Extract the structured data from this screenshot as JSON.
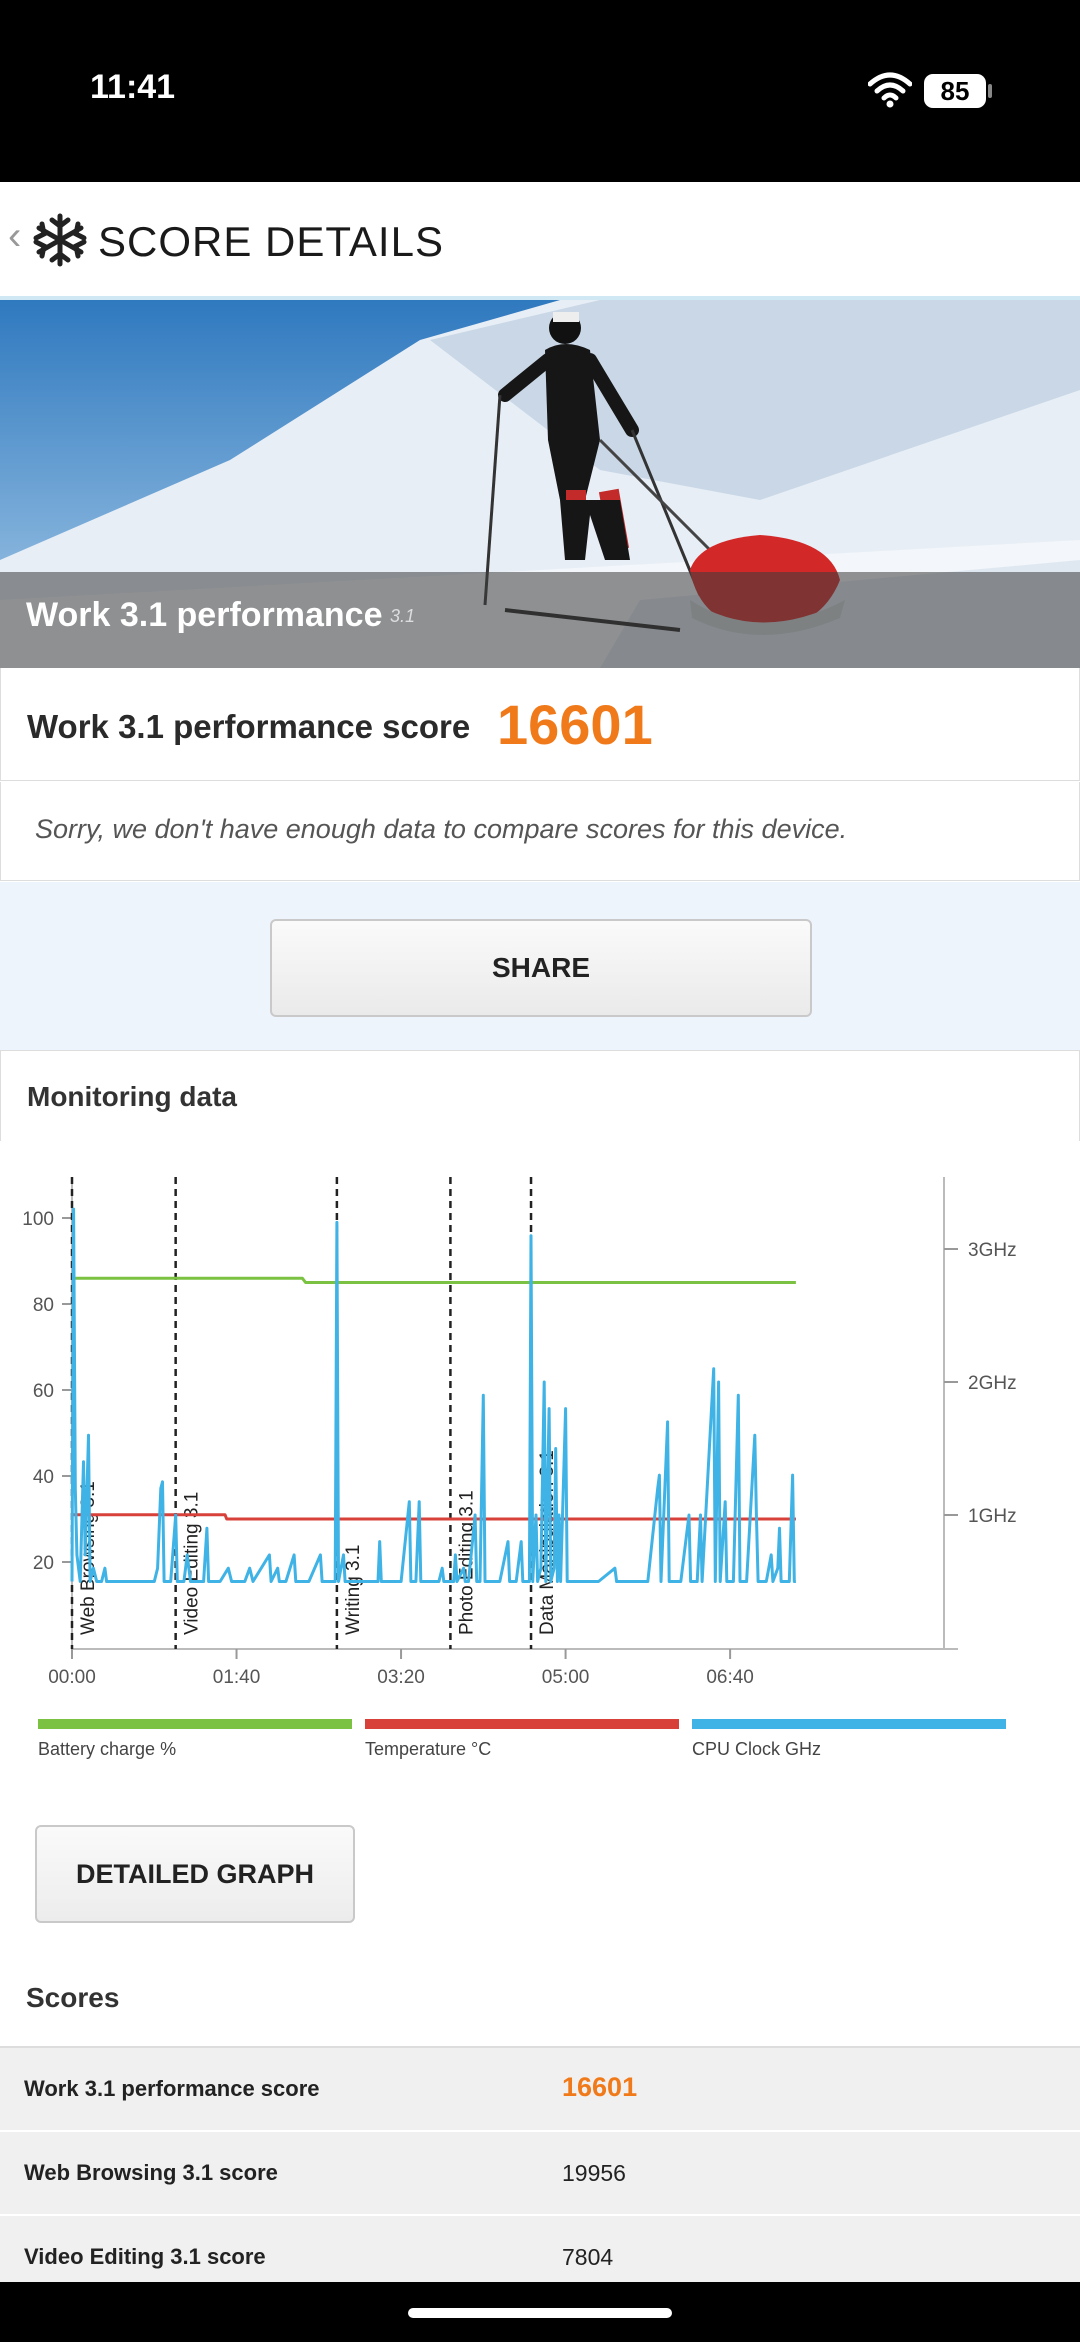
{
  "status_bar": {
    "time": "11:41",
    "battery": "85"
  },
  "header": {
    "title": "SCORE DETAILS",
    "back_glyph": "‹"
  },
  "hero": {
    "title": "Work 3.1 performance",
    "version": "3.1"
  },
  "score": {
    "label": "Work 3.1 performance score",
    "value": "16601"
  },
  "notice": "Sorry, we don't have enough data to compare scores for this device.",
  "share_label": "SHARE",
  "monitoring": {
    "title": "Monitoring data"
  },
  "colors": {
    "battery": "#7cc242",
    "temperature": "#d8403a",
    "cpu": "#3fb3e5",
    "accent": "#f07a1a"
  },
  "chart_data": {
    "type": "line",
    "x_ticks": [
      "00:00",
      "01:40",
      "03:20",
      "05:00",
      "06:40"
    ],
    "x_range_seconds": [
      0,
      530
    ],
    "y_left_ticks": [
      "100",
      "80",
      "60",
      "40",
      "20"
    ],
    "y_left_range": [
      0,
      100
    ],
    "y_right_ticks": [
      "3GHz",
      "2GHz",
      "1GHz"
    ],
    "y_right_range_ghz": [
      0,
      3.5
    ],
    "markers": [
      {
        "label": "Web Browsing 3.1",
        "t": 0
      },
      {
        "label": "Video Editing 3.1",
        "t": 63
      },
      {
        "label": "Writing 3.1",
        "t": 161
      },
      {
        "label": "Photo Editing 3.1",
        "t": 230
      },
      {
        "label": "Data Manipulation 3.1",
        "t": 279
      }
    ],
    "series": [
      {
        "name": "Battery charge %",
        "axis": "left",
        "points": [
          [
            0,
            86
          ],
          [
            140,
            86
          ],
          [
            142,
            85
          ],
          [
            440,
            85
          ]
        ]
      },
      {
        "name": "Temperature °C",
        "axis": "left",
        "points": [
          [
            0,
            31
          ],
          [
            93,
            31
          ],
          [
            94,
            30
          ],
          [
            440,
            30
          ]
        ]
      },
      {
        "name": "CPU Clock GHz",
        "axis": "right",
        "points": [
          [
            0,
            0.5
          ],
          [
            1,
            3.3
          ],
          [
            2,
            1.2
          ],
          [
            3,
            0.7
          ],
          [
            5,
            0.5
          ],
          [
            7,
            1.4
          ],
          [
            8,
            0.7
          ],
          [
            10,
            1.6
          ],
          [
            11,
            0.5
          ],
          [
            13,
            0.6
          ],
          [
            15,
            0.5
          ],
          [
            18,
            0.5
          ],
          [
            20,
            0.6
          ],
          [
            21,
            0.5
          ],
          [
            30,
            0.5
          ],
          [
            40,
            0.5
          ],
          [
            50,
            0.5
          ],
          [
            52,
            0.6
          ],
          [
            54,
            1.2
          ],
          [
            55,
            1.25
          ],
          [
            56,
            0.5
          ],
          [
            60,
            0.5
          ],
          [
            63,
            1.0
          ],
          [
            64,
            0.5
          ],
          [
            68,
            0.5
          ],
          [
            70,
            0.7
          ],
          [
            72,
            0.5
          ],
          [
            80,
            0.5
          ],
          [
            82,
            0.9
          ],
          [
            83,
            0.5
          ],
          [
            90,
            0.5
          ],
          [
            95,
            0.6
          ],
          [
            97,
            0.5
          ],
          [
            103,
            0.5
          ],
          [
            105,
            0.5
          ],
          [
            108,
            0.6
          ],
          [
            110,
            0.5
          ],
          [
            120,
            0.7
          ],
          [
            121,
            0.5
          ],
          [
            125,
            0.6
          ],
          [
            126,
            0.5
          ],
          [
            130,
            0.5
          ],
          [
            135,
            0.7
          ],
          [
            136,
            0.5
          ],
          [
            144,
            0.5
          ],
          [
            151,
            0.7
          ],
          [
            152,
            0.5
          ],
          [
            158,
            0.5
          ],
          [
            160,
            0.5
          ],
          [
            161,
            3.2
          ],
          [
            162,
            0.5
          ],
          [
            165,
            0.7
          ],
          [
            166,
            0.5
          ],
          [
            175,
            0.5
          ],
          [
            186,
            0.5
          ],
          [
            187,
            0.8
          ],
          [
            188,
            0.5
          ],
          [
            200,
            0.5
          ],
          [
            205,
            1.1
          ],
          [
            206,
            0.5
          ],
          [
            209,
            0.5
          ],
          [
            211,
            1.1
          ],
          [
            212,
            0.5
          ],
          [
            223,
            0.5
          ],
          [
            225,
            0.6
          ],
          [
            226,
            0.5
          ],
          [
            232,
            0.5
          ],
          [
            233,
            0.7
          ],
          [
            234,
            0.5
          ],
          [
            238,
            0.6
          ],
          [
            239,
            0.5
          ],
          [
            241,
            0.5
          ],
          [
            245,
            1.0
          ],
          [
            246,
            0.5
          ],
          [
            248,
            0.5
          ],
          [
            250,
            1.9
          ],
          [
            251,
            0.5
          ],
          [
            260,
            0.5
          ],
          [
            265,
            0.8
          ],
          [
            266,
            0.5
          ],
          [
            270,
            0.5
          ],
          [
            273,
            0.8
          ],
          [
            274,
            0.5
          ],
          [
            278,
            0.5
          ],
          [
            279,
            3.1
          ],
          [
            280,
            0.5
          ],
          [
            282,
            1.0
          ],
          [
            283,
            0.5
          ],
          [
            285,
            0.6
          ],
          [
            287,
            2.0
          ],
          [
            288,
            0.5
          ],
          [
            290,
            1.8
          ],
          [
            291,
            0.5
          ],
          [
            293,
            0.6
          ],
          [
            294,
            1.5
          ],
          [
            295,
            0.5
          ],
          [
            296,
            1.0
          ],
          [
            297,
            0.5
          ],
          [
            300,
            1.8
          ],
          [
            301,
            0.5
          ],
          [
            305,
            0.5
          ],
          [
            320,
            0.5
          ],
          [
            330,
            0.6
          ],
          [
            331,
            0.5
          ],
          [
            350,
            0.5
          ],
          [
            356,
            1.2
          ],
          [
            357,
            1.3
          ],
          [
            358,
            0.5
          ],
          [
            362,
            1.7
          ],
          [
            363,
            0.5
          ],
          [
            370,
            0.5
          ],
          [
            375,
            1.0
          ],
          [
            376,
            0.5
          ],
          [
            380,
            0.5
          ],
          [
            382,
            1.0
          ],
          [
            383,
            0.5
          ],
          [
            390,
            2.1
          ],
          [
            391,
            0.5
          ],
          [
            393,
            2.0
          ],
          [
            394,
            0.5
          ],
          [
            397,
            1.1
          ],
          [
            398,
            0.5
          ],
          [
            402,
            0.5
          ],
          [
            405,
            1.9
          ],
          [
            406,
            0.5
          ],
          [
            410,
            0.5
          ],
          [
            415,
            1.6
          ],
          [
            416,
            1.0
          ],
          [
            417,
            0.5
          ],
          [
            422,
            0.5
          ],
          [
            425,
            0.7
          ],
          [
            426,
            0.5
          ],
          [
            429,
            0.6
          ],
          [
            430,
            0.9
          ],
          [
            431,
            0.5
          ],
          [
            436,
            0.5
          ],
          [
            438,
            1.3
          ],
          [
            439,
            0.5
          ],
          [
            440,
            0.5
          ]
        ]
      }
    ],
    "legend": [
      "Battery charge %",
      "Temperature °C",
      "CPU Clock GHz"
    ],
    "legend_position": "bottom"
  },
  "detailed_graph_label": "DETAILED GRAPH",
  "scores": {
    "title": "Scores",
    "rows": [
      {
        "name": "Work 3.1 performance score",
        "value": "16601"
      },
      {
        "name": "Web Browsing 3.1 score",
        "value": "19956"
      },
      {
        "name": "Video Editing 3.1 score",
        "value": "7804"
      }
    ]
  }
}
